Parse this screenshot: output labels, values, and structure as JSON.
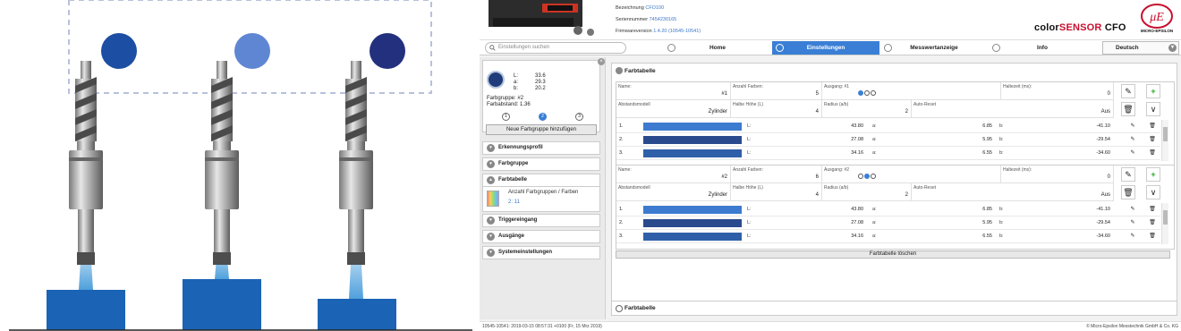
{
  "header": {
    "device_rows": [
      {
        "label": "Bezeichnung",
        "value": "CFO100"
      },
      {
        "label": "Seriennummer",
        "value": "7454230165"
      },
      {
        "label": "Firmwareversion",
        "value": "1.4.20 (10545-10541)"
      }
    ],
    "brand_prefix": "color",
    "brand_highlight": "SENSOR",
    "brand_suffix": " CFO",
    "logo_text": "MICRO-EPSILON"
  },
  "nav": {
    "search_placeholder": "Einstellungen suchen",
    "tabs": [
      {
        "label": "Home",
        "active": false
      },
      {
        "label": "Einstellungen",
        "active": true
      },
      {
        "label": "Messwertanzeige",
        "active": false
      },
      {
        "label": "Info",
        "active": false
      }
    ],
    "language": "Deutsch"
  },
  "sidebar": {
    "lab": [
      {
        "k": "L:",
        "v": "33.6"
      },
      {
        "k": "a:",
        "v": "29.3"
      },
      {
        "k": "b:",
        "v": "20.2"
      }
    ],
    "farbgruppe": "Farbgruppe: #2",
    "farbabstand": "Farbabstand: 1.36",
    "radios": [
      "1",
      "2",
      "3"
    ],
    "selected_radio": "2",
    "add_button": "Neue Farbgruppe hinzufügen",
    "accordion": [
      "Erkennungsprofil",
      "Farbgruppe",
      "Farbtabelle",
      "Triggereingang",
      "Ausgänge",
      "Systemeinstellungen"
    ],
    "farbtabelle_body_title": "Anzahl Farbgruppen / Farben",
    "farbtabelle_body_value": "2: 11"
  },
  "main": {
    "title": "Farbtabelle",
    "groups": [
      {
        "name_label": "Name:",
        "name": "#1",
        "count_label": "Anzahl Farben:",
        "count": "5",
        "output_label": "Ausgang: #1",
        "output_selected": 1,
        "hold_label": "Haltezeit (ms):",
        "hold": "0",
        "dist_label": "Abstandsmodell",
        "dist": "Zylinder",
        "half_label": "Halbe Höhe (L)",
        "half": "4",
        "radius_label": "Radius (a/b)",
        "radius": "2",
        "reset_label": "Auto-Reset",
        "reset": "Aus",
        "rows": [
          {
            "n": "1.",
            "color": "#3d7bd0",
            "L": "43.80",
            "a": "6.85",
            "b": "-41.10"
          },
          {
            "n": "2.",
            "color": "#2a4a8e",
            "L": "27.08",
            "a": "5.95",
            "b": "-29.54"
          },
          {
            "n": "3.",
            "color": "#2f5fa8",
            "L": "34.16",
            "a": "6.55",
            "b": "-34.60"
          }
        ]
      },
      {
        "name_label": "Name:",
        "name": "#2",
        "count_label": "Anzahl Farben:",
        "count": "6",
        "output_label": "Ausgang: #2",
        "output_selected": 2,
        "hold_label": "Haltezeit (ms):",
        "hold": "0",
        "dist_label": "Abstandsmodell",
        "dist": "Zylinder",
        "half_label": "Halbe Höhe (L)",
        "half": "4",
        "radius_label": "Radius (a/b)",
        "radius": "2",
        "reset_label": "Auto-Reset",
        "reset": "Aus",
        "rows": [
          {
            "n": "1.",
            "color": "#3d7bd0",
            "L": "43.80",
            "a": "6.85",
            "b": "-41.10"
          },
          {
            "n": "2.",
            "color": "#2a4a8e",
            "L": "27.08",
            "a": "5.95",
            "b": "-29.54"
          },
          {
            "n": "3.",
            "color": "#2f5fa8",
            "L": "34.16",
            "a": "6.55",
            "b": "-34.60"
          }
        ]
      }
    ],
    "clear_button": "Farbtabelle löschen"
  },
  "info_box": "Farbtabelle",
  "footer": {
    "left": "10545-10541: 2019-03-15 08:57:31 +0100 (Fr, 15 Mrz 2019)",
    "right": "© Micro-Epsilon Messtechnik GmbH & Co. KG"
  },
  "colors": {
    "accent": "#3a7fd5",
    "ball_left": "#1c4fa3",
    "ball_middle": "#5f86d2",
    "ball_right": "#23307e",
    "target_box": "#1b63b4",
    "brand_red": "#c8102e"
  }
}
